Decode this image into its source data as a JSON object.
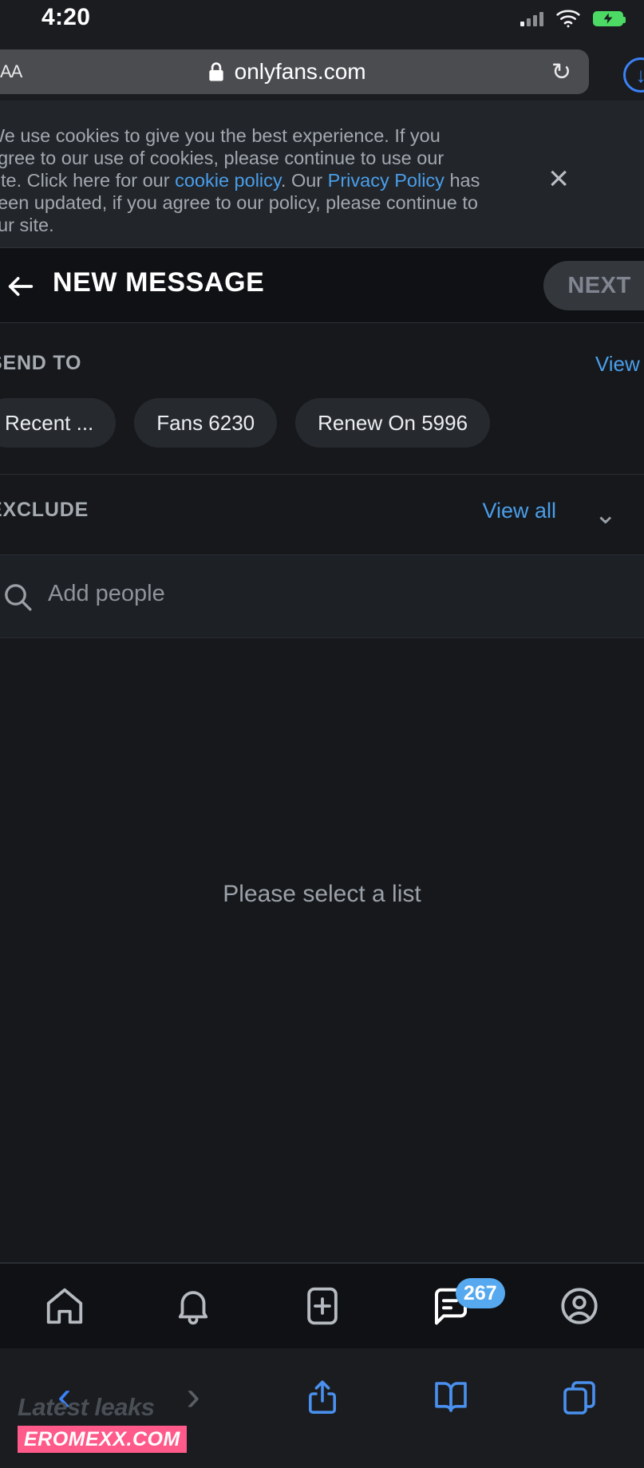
{
  "status_bar": {
    "time": "4:20",
    "signal_icon": "cellular-signal-icon",
    "wifi_icon": "wifi-icon",
    "battery_icon": "battery-charging-icon"
  },
  "browser": {
    "text_size_label": "AA",
    "lock_icon": "lock-icon",
    "url": "onlyfans.com",
    "reload_icon": "reload-icon",
    "downloads_icon": "downloads-icon"
  },
  "cookie_banner": {
    "part1": "We use cookies to give you the best experience. If you agree to our use of cookies, please continue to use our site. Click here for our ",
    "link1": "cookie policy",
    "part2": ". Our ",
    "link2": "Privacy Policy",
    "part3": " has been updated, if you agree to our policy, please continue to our site.",
    "close_label": "×"
  },
  "header": {
    "back_icon": "back-arrow-icon",
    "title": "NEW MESSAGE",
    "next_label": "NEXT"
  },
  "send_to": {
    "label": "SEND TO",
    "view_all": "View all",
    "chips": [
      {
        "label": "Recent ..."
      },
      {
        "label": "Fans 6230"
      },
      {
        "label": "Renew On 5996"
      }
    ]
  },
  "exclude": {
    "label": "EXCLUDE",
    "view_all": "View all",
    "chevron_icon": "chevron-down-icon"
  },
  "search": {
    "icon": "search-icon",
    "placeholder": "Add people"
  },
  "content": {
    "empty_message": "Please select a list"
  },
  "bottom_nav": {
    "items": [
      {
        "name": "home-icon"
      },
      {
        "name": "notifications-bell-icon"
      },
      {
        "name": "add-post-icon"
      },
      {
        "name": "messages-icon",
        "badge": "267"
      },
      {
        "name": "profile-icon"
      }
    ]
  },
  "safari_toolbar": {
    "back_icon": "chevron-left-icon",
    "forward_icon": "chevron-right-icon",
    "share_icon": "share-icon",
    "bookmarks_icon": "book-icon",
    "tabs_icon": "tabs-icon"
  },
  "watermark": {
    "line1": "Latest leaks",
    "line2": "EROMEXX.COM"
  },
  "colors": {
    "accent_blue": "#4a9eea",
    "badge_blue": "#56a9ef",
    "page_bg": "#16181c",
    "watermark_pink": "#ff5a8a"
  }
}
